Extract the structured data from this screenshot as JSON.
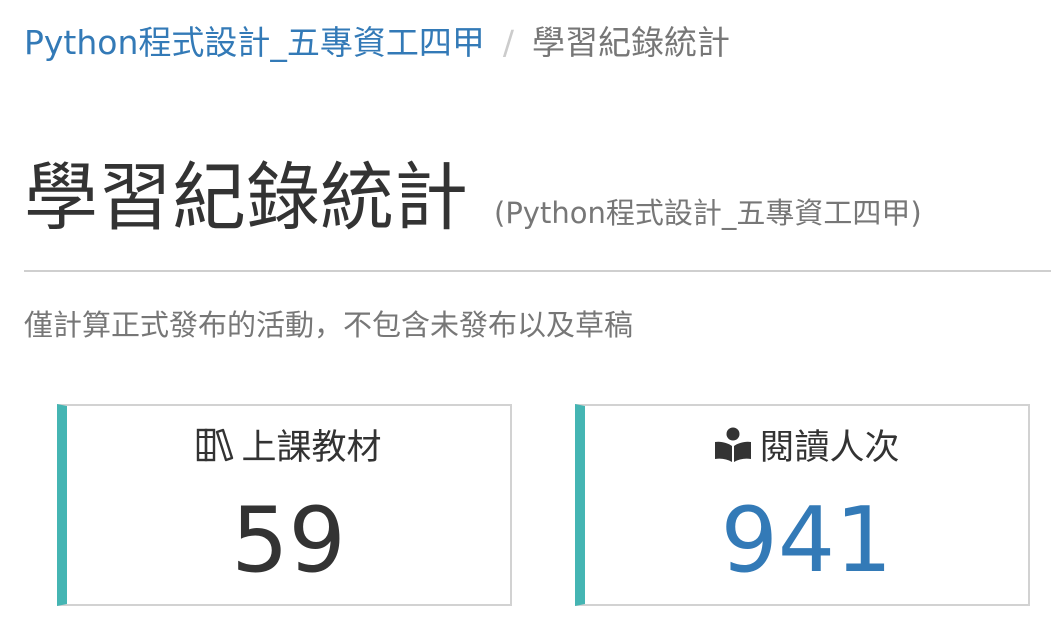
{
  "breadcrumb": {
    "course_link": "Python程式設計_五專資工四甲",
    "separator": "/",
    "current": "學習紀錄統計"
  },
  "header": {
    "title": "學習紀錄統計",
    "subtitle": "(Python程式設計_五專資工四甲)"
  },
  "notice": "僅計算正式發布的活動，不包含未發布以及草稿",
  "stats": [
    {
      "icon": "books-icon",
      "label": "上課教材",
      "value": "59",
      "value_color": "#333333"
    },
    {
      "icon": "reader-icon",
      "label": "閱讀人次",
      "value": "941",
      "value_color": "#337ab7"
    }
  ],
  "colors": {
    "accent": "#45b5b3",
    "link": "#337ab7",
    "muted": "#777777"
  }
}
